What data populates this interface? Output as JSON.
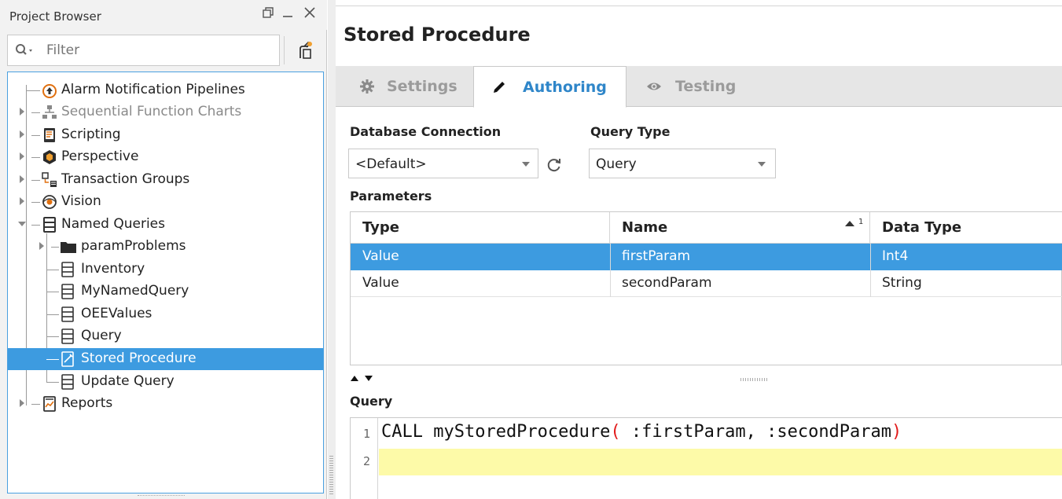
{
  "project_browser": {
    "title": "Project Browser",
    "filter_placeholder": "Filter",
    "tree": [
      {
        "label": "Alarm Notification Pipelines",
        "icon": "alarm-pipeline-icon",
        "enabled": true
      },
      {
        "label": "Sequential Function Charts",
        "icon": "sfc-icon",
        "enabled": false
      },
      {
        "label": "Scripting",
        "icon": "script-icon",
        "enabled": true
      },
      {
        "label": "Perspective",
        "icon": "perspective-icon",
        "enabled": true
      },
      {
        "label": "Transaction Groups",
        "icon": "transaction-groups-icon",
        "enabled": true
      },
      {
        "label": "Vision",
        "icon": "vision-icon",
        "enabled": true
      },
      {
        "label": "Named Queries",
        "icon": "named-query-icon",
        "enabled": true
      },
      {
        "label": "paramProblems",
        "icon": "folder-icon",
        "enabled": true
      },
      {
        "label": "Inventory",
        "icon": "query-icon",
        "enabled": true
      },
      {
        "label": "MyNamedQuery",
        "icon": "query-icon",
        "enabled": true
      },
      {
        "label": "OEEValues",
        "icon": "query-icon",
        "enabled": true
      },
      {
        "label": "Query",
        "icon": "query-icon",
        "enabled": true
      },
      {
        "label": "Stored Procedure",
        "icon": "stored-procedure-icon",
        "enabled": true,
        "selected": true
      },
      {
        "label": "Update Query",
        "icon": "query-icon",
        "enabled": true
      },
      {
        "label": "Reports",
        "icon": "reports-icon",
        "enabled": true
      }
    ]
  },
  "editor": {
    "title": "Stored Procedure",
    "tabs": [
      {
        "label": "Settings",
        "icon": "gear-icon",
        "active": false
      },
      {
        "label": "Authoring",
        "icon": "pencil-icon",
        "active": true
      },
      {
        "label": "Testing",
        "icon": "eye-icon",
        "active": false
      }
    ],
    "database_connection": {
      "label": "Database Connection",
      "value": "<Default>"
    },
    "query_type": {
      "label": "Query Type",
      "value": "Query"
    },
    "parameters": {
      "label": "Parameters",
      "columns": [
        "Type",
        "Name",
        "Data Type"
      ],
      "sort_column": "Name",
      "sort_order": "1",
      "rows": [
        {
          "type": "Value",
          "name": "firstParam",
          "data_type": "Int4",
          "selected": true
        },
        {
          "type": "Value",
          "name": "secondParam",
          "data_type": "String",
          "selected": false
        }
      ]
    },
    "query": {
      "label": "Query",
      "line_numbers": [
        "1",
        "2"
      ],
      "line1_prefix": "CALL myStoredProcedure",
      "line1_open": "(",
      "line1_args": " :firstParam, :secondParam",
      "line1_close": ")",
      "line2": ""
    }
  },
  "colors": {
    "selection": "#3d9be0",
    "active_tab_text": "#2f86c9",
    "highlight_line": "#fdfaa8",
    "paren": "#e21b1b"
  }
}
